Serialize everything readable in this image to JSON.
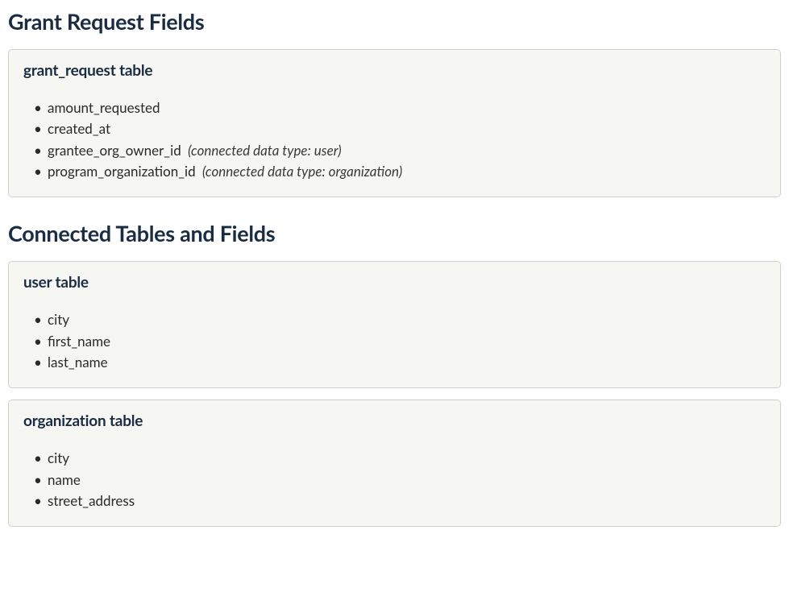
{
  "sections": [
    {
      "heading": "Grant Request Fields",
      "cards": [
        {
          "title": "grant_request table",
          "fields": [
            {
              "name": "amount_requested",
              "note": ""
            },
            {
              "name": "created_at",
              "note": ""
            },
            {
              "name": "grantee_org_owner_id",
              "note": "(connected data type: user)"
            },
            {
              "name": "program_organization_id",
              "note": "(connected data type: organization)"
            }
          ]
        }
      ]
    },
    {
      "heading": "Connected Tables and Fields",
      "cards": [
        {
          "title": "user table",
          "fields": [
            {
              "name": "city",
              "note": ""
            },
            {
              "name": "first_name",
              "note": ""
            },
            {
              "name": "last_name",
              "note": ""
            }
          ]
        },
        {
          "title": "organization table",
          "fields": [
            {
              "name": "city",
              "note": ""
            },
            {
              "name": "name",
              "note": ""
            },
            {
              "name": "street_address",
              "note": ""
            }
          ]
        }
      ]
    }
  ]
}
